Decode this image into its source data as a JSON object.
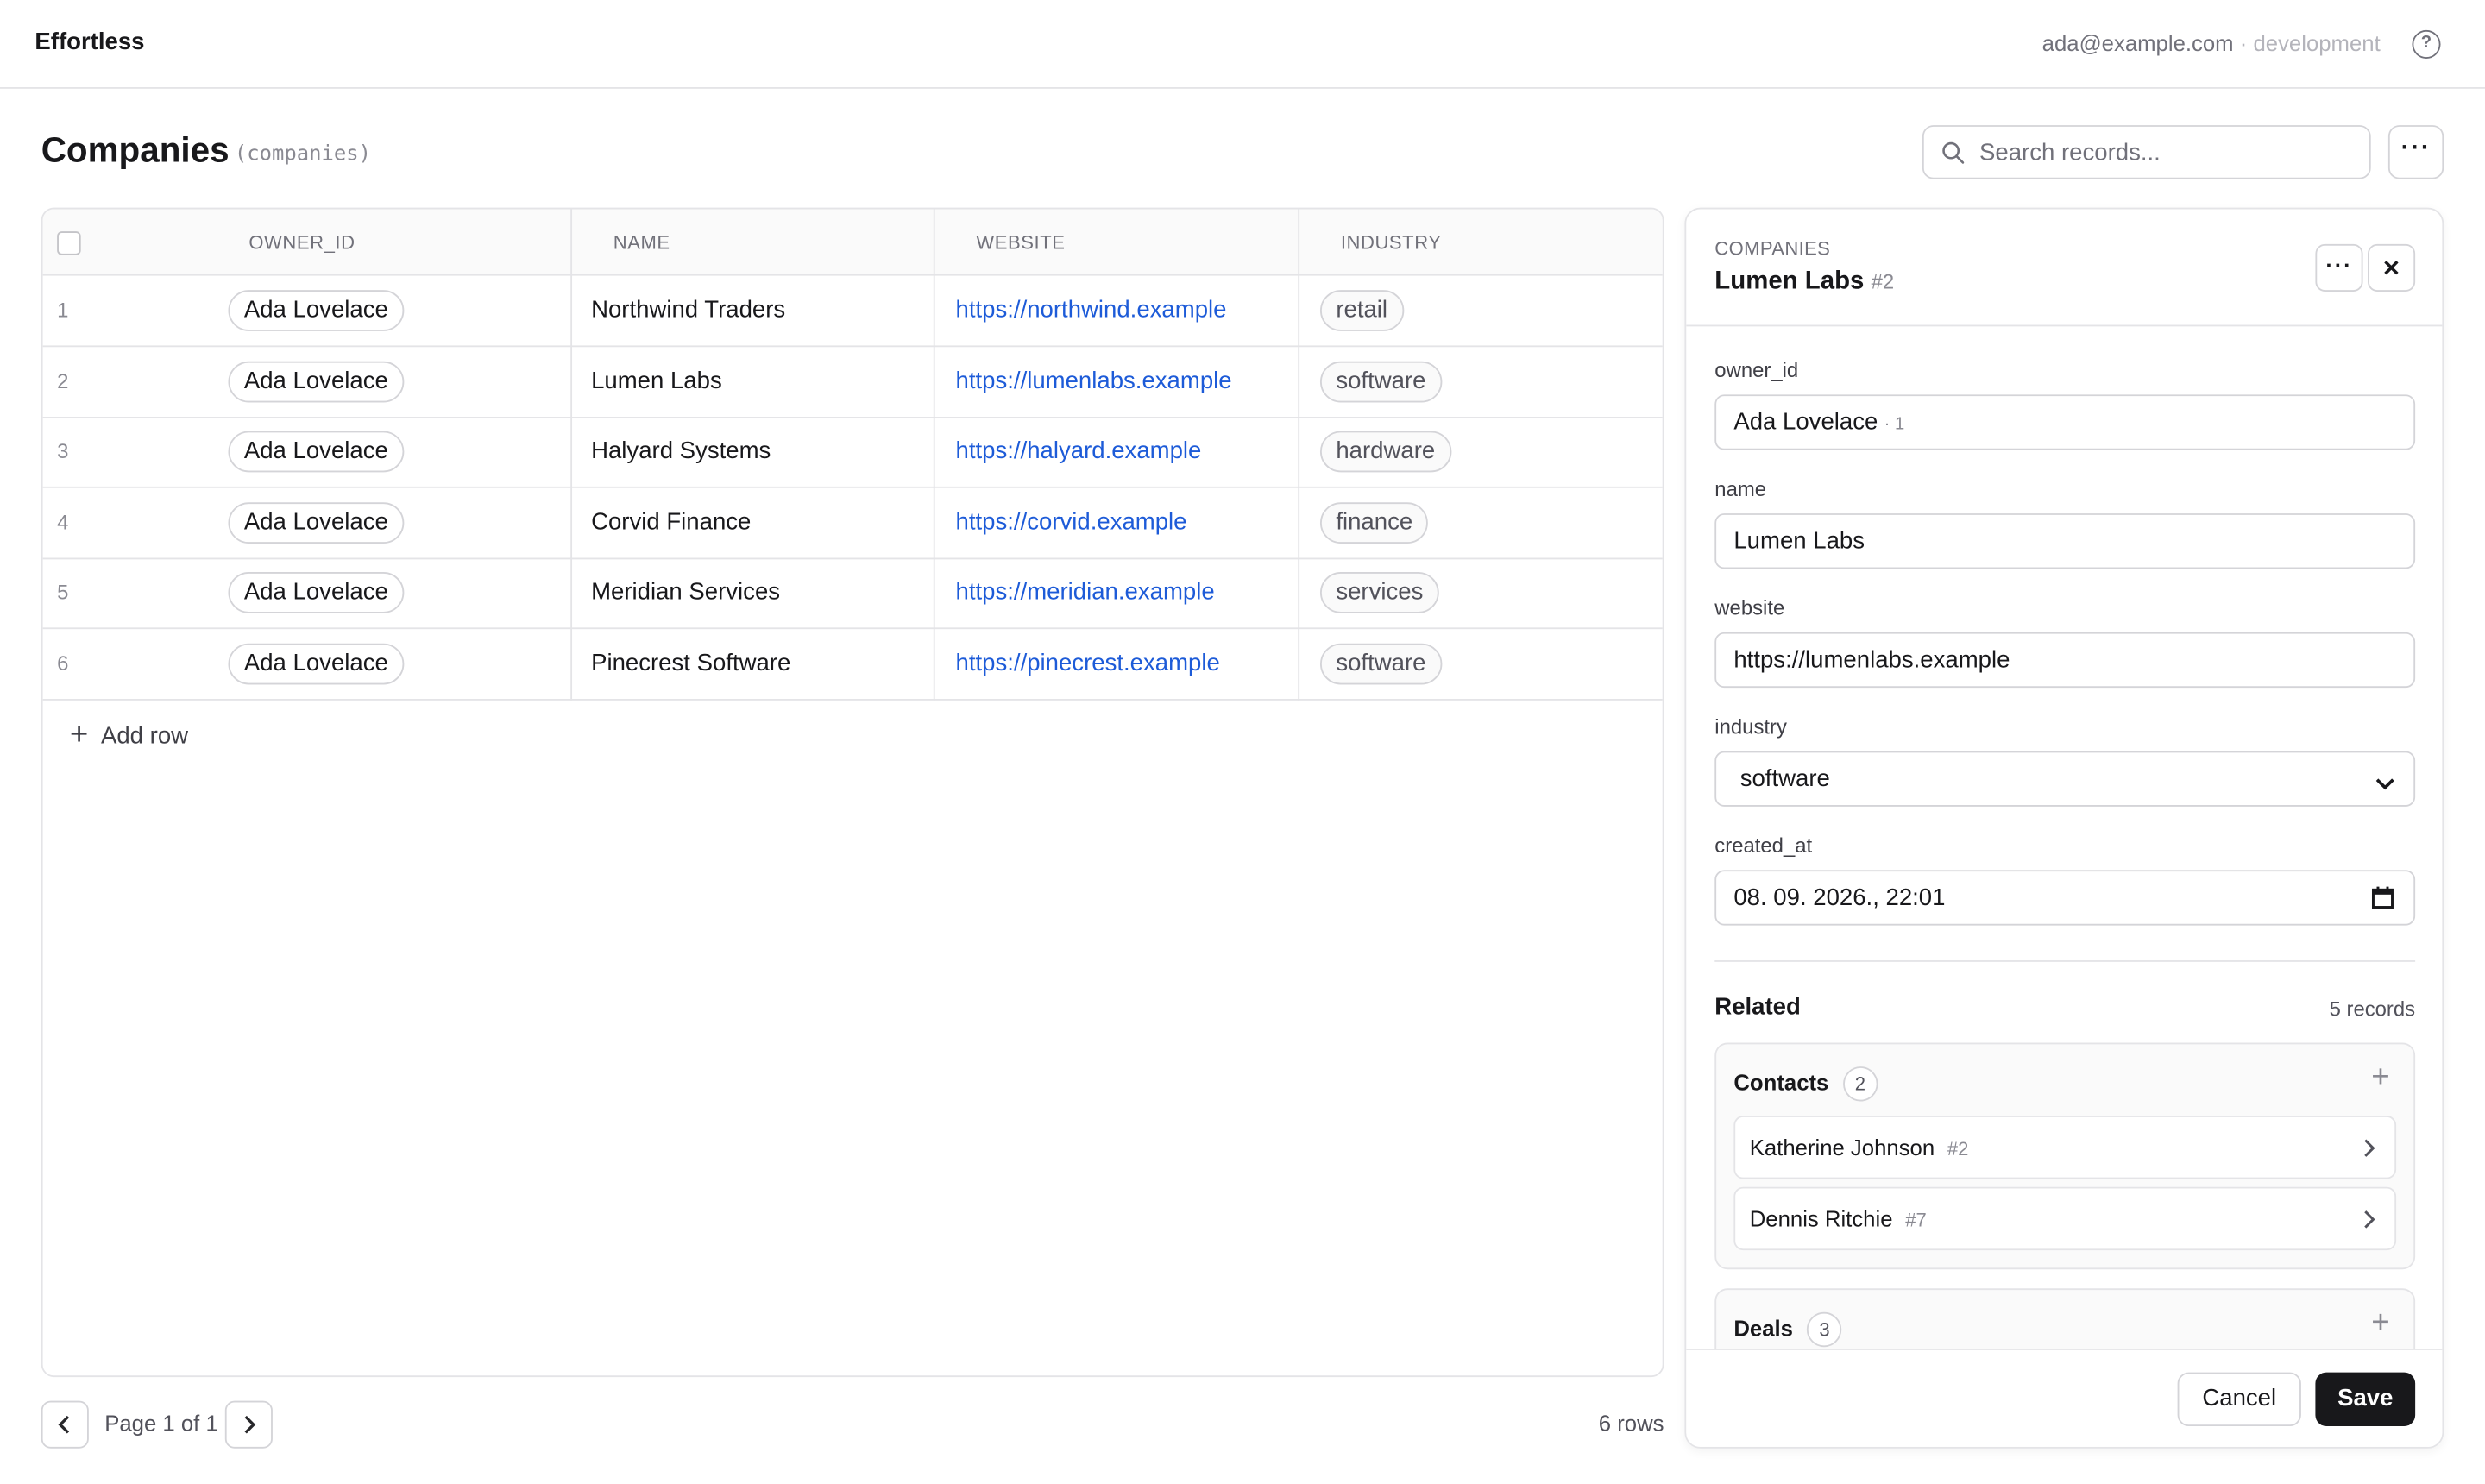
{
  "app": {
    "name": "Effortless",
    "account_email": "ada@example.com",
    "separator": " · ",
    "environment": "development",
    "help_icon": "help-icon"
  },
  "page": {
    "title": "Companies",
    "table_name": "(companies)"
  },
  "search": {
    "placeholder": "Search records..."
  },
  "table": {
    "columns": [
      "OWNER_ID",
      "NAME",
      "WEBSITE",
      "INDUSTRY"
    ],
    "rows": [
      {
        "index": "1",
        "owner": "Ada Lovelace",
        "name": "Northwind Traders",
        "website": "https://northwind.example",
        "industry": "retail"
      },
      {
        "index": "2",
        "owner": "Ada Lovelace",
        "name": "Lumen Labs",
        "website": "https://lumenlabs.example",
        "industry": "software"
      },
      {
        "index": "3",
        "owner": "Ada Lovelace",
        "name": "Halyard Systems",
        "website": "https://halyard.example",
        "industry": "hardware"
      },
      {
        "index": "4",
        "owner": "Ada Lovelace",
        "name": "Corvid Finance",
        "website": "https://corvid.example",
        "industry": "finance"
      },
      {
        "index": "5",
        "owner": "Ada Lovelace",
        "name": "Meridian Services",
        "website": "https://meridian.example",
        "industry": "services"
      },
      {
        "index": "6",
        "owner": "Ada Lovelace",
        "name": "Pinecrest Software",
        "website": "https://pinecrest.example",
        "industry": "software"
      }
    ],
    "add_row_label": "Add row",
    "page_label": "Page 1 of 1",
    "row_count": "6 rows"
  },
  "panel": {
    "kicker": "COMPANIES",
    "title": "Lumen Labs",
    "record_id": "#2",
    "fields": {
      "owner_id": {
        "label": "owner_id",
        "value": "Ada Lovelace",
        "suffix": "· 1"
      },
      "name": {
        "label": "name",
        "value": "Lumen Labs"
      },
      "website": {
        "label": "website",
        "value": "https://lumenlabs.example"
      },
      "industry": {
        "label": "industry",
        "value": "software"
      },
      "created_at": {
        "label": "created_at",
        "value": "08. 09. 2026., 22:01"
      }
    },
    "related": {
      "title": "Related",
      "count": "5 records",
      "groups": [
        {
          "name": "Contacts",
          "count": "2",
          "items": [
            {
              "name": "Katherine Johnson",
              "id": "#2"
            },
            {
              "name": "Dennis Ritchie",
              "id": "#7"
            }
          ]
        },
        {
          "name": "Deals",
          "count": "3"
        }
      ]
    },
    "cancel_label": "Cancel",
    "save_label": "Save"
  },
  "colors": {
    "link": "#1d5bd8",
    "primary_button": "#18181b",
    "border": "#e4e4e7"
  }
}
